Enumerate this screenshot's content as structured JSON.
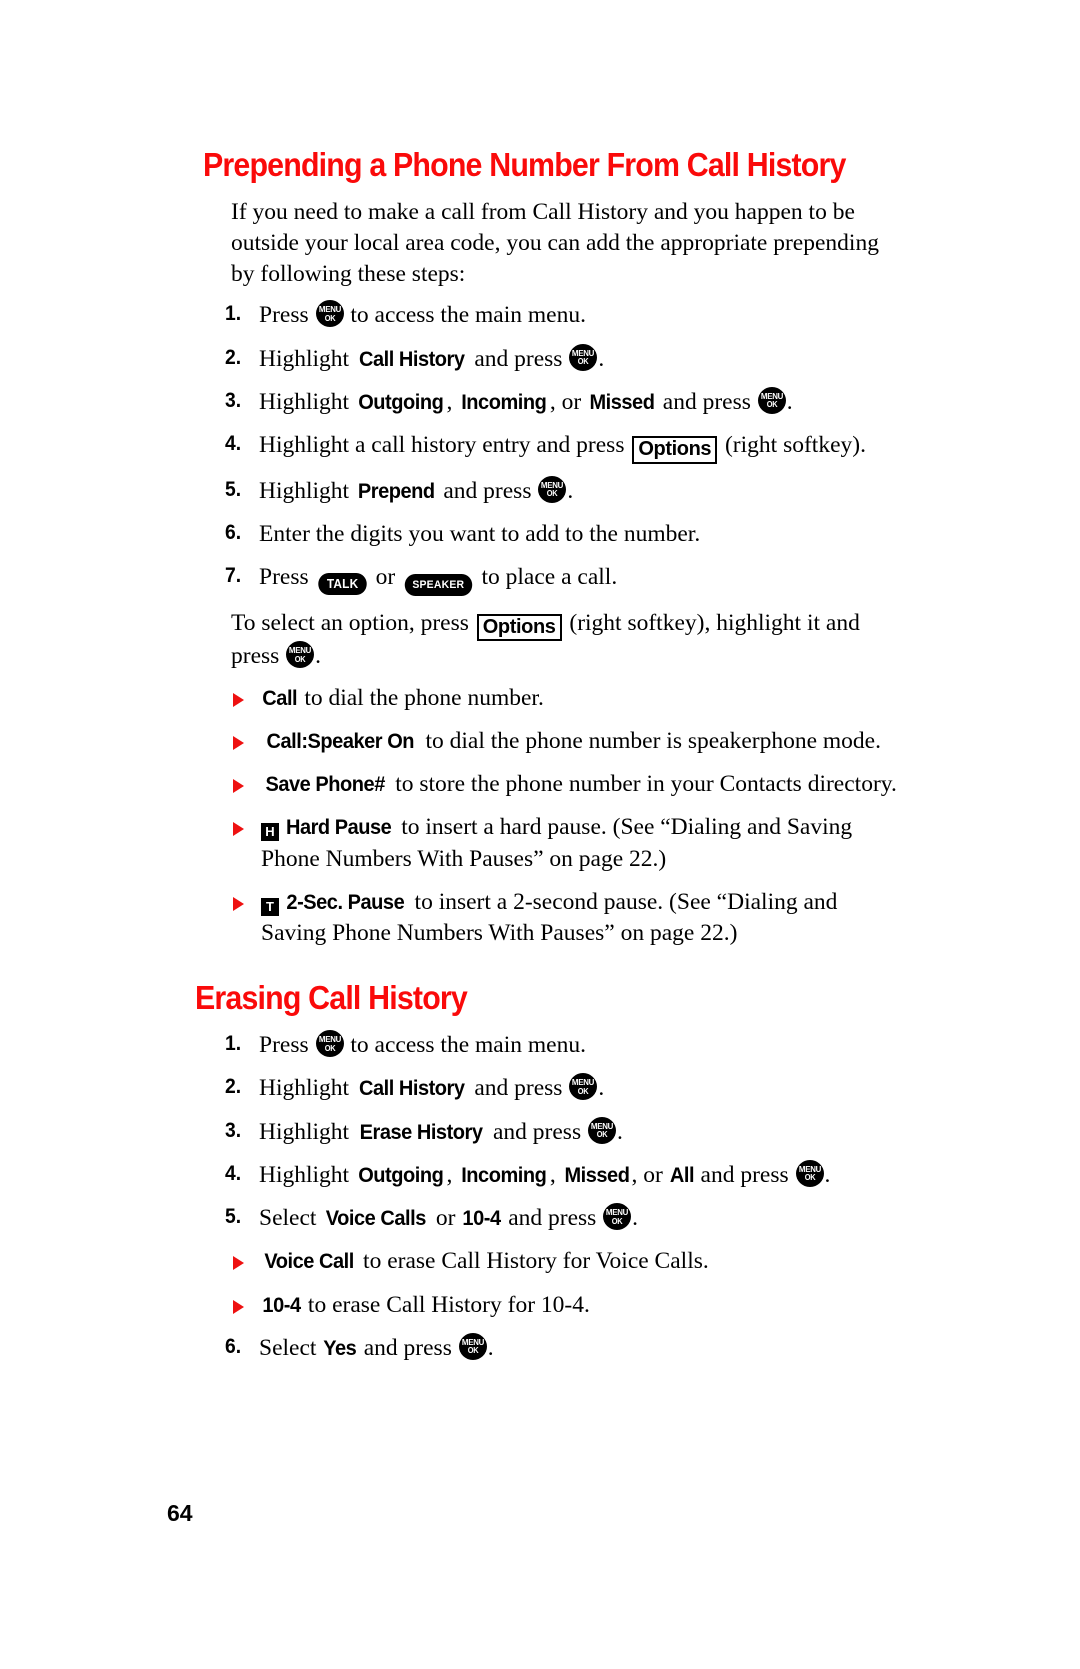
{
  "page": {
    "folio": "64",
    "accent_red": "#fa0a0a",
    "text_black": "#000000",
    "background": "#ffffff"
  },
  "icons": {
    "menu_ok": {
      "line1": "MENU",
      "line2": "OK",
      "name": "menu-ok-key-icon"
    },
    "talk": {
      "label": "TALK",
      "name": "talk-key-icon"
    },
    "speaker": {
      "label": "SPEAKER",
      "name": "speaker-key-icon"
    },
    "options_softkey": {
      "label": "Options",
      "name": "options-softkey-icon"
    },
    "hard_pause": {
      "label": "H",
      "name": "hard-pause-key-icon"
    },
    "two_sec_pause": {
      "label": "T",
      "name": "two-sec-pause-key-icon"
    }
  },
  "sections": [
    {
      "heading": "Prepending a Phone Number From Call History",
      "intro": "If you need to make a call from Call History and you happen to be outside your local area code, you can add the appropriate prepending by following these steps:",
      "steps": [
        {
          "num": "1.",
          "parts": [
            {
              "t": "text",
              "v": "Press "
            },
            {
              "t": "menuok"
            },
            {
              "t": "text",
              "v": " to access the main menu."
            }
          ]
        },
        {
          "num": "2.",
          "parts": [
            {
              "t": "text",
              "v": "Highlight "
            },
            {
              "t": "ui",
              "v": "Call History"
            },
            {
              "t": "text",
              "v": " and press "
            },
            {
              "t": "menuok"
            },
            {
              "t": "text",
              "v": "."
            }
          ]
        },
        {
          "num": "3.",
          "parts": [
            {
              "t": "text",
              "v": "Highlight "
            },
            {
              "t": "ui",
              "v": "Outgoing"
            },
            {
              "t": "text",
              "v": ", "
            },
            {
              "t": "ui",
              "v": "Incoming"
            },
            {
              "t": "text",
              "v": ", or "
            },
            {
              "t": "ui",
              "v": "Missed"
            },
            {
              "t": "text",
              "v": " and press "
            },
            {
              "t": "menuok"
            },
            {
              "t": "text",
              "v": "."
            }
          ]
        },
        {
          "num": "4.",
          "parts": [
            {
              "t": "text",
              "v": "Highlight a call history entry and press "
            },
            {
              "t": "box",
              "v": "Options"
            },
            {
              "t": "text",
              "v": " (right softkey)."
            }
          ]
        },
        {
          "num": "5.",
          "parts": [
            {
              "t": "text",
              "v": "Highlight "
            },
            {
              "t": "ui",
              "v": "Prepend"
            },
            {
              "t": "text",
              "v": " and press "
            },
            {
              "t": "menuok"
            },
            {
              "t": "text",
              "v": "."
            }
          ]
        },
        {
          "num": "6.",
          "parts": [
            {
              "t": "text",
              "v": "Enter the digits you want to add to the number."
            }
          ]
        },
        {
          "num": "7.",
          "parts": [
            {
              "t": "text",
              "v": "Press "
            },
            {
              "t": "pill",
              "v": "TALK"
            },
            {
              "t": "text",
              "v": " or "
            },
            {
              "t": "pillsm",
              "v": "SPEAKER"
            },
            {
              "t": "text",
              "v": " to place a call."
            }
          ]
        }
      ],
      "after_steps_paragraph": [
        {
          "t": "text",
          "v": "To select an option, press "
        },
        {
          "t": "box",
          "v": "Options"
        },
        {
          "t": "text",
          "v": " (right softkey), highlight it and press "
        },
        {
          "t": "menuok"
        },
        {
          "t": "text",
          "v": "."
        }
      ],
      "bullets": [
        {
          "parts": [
            {
              "t": "ui",
              "v": "Call"
            },
            {
              "t": "text",
              "v": " to dial the phone number."
            }
          ]
        },
        {
          "parts": [
            {
              "t": "ui",
              "v": "Call:Speaker On"
            },
            {
              "t": "text",
              "v": " to dial the phone number is speakerphone mode."
            }
          ]
        },
        {
          "parts": [
            {
              "t": "ui",
              "v": "Save Phone#"
            },
            {
              "t": "text",
              "v": " to store the phone number in your Contacts directory."
            }
          ]
        },
        {
          "parts": [
            {
              "t": "sq",
              "v": "H"
            },
            {
              "t": "ui",
              "v": "Hard Pause"
            },
            {
              "t": "text",
              "v": " to insert a hard pause. (See “Dialing and Saving Phone Numbers With Pauses” on page 22.)"
            }
          ]
        },
        {
          "parts": [
            {
              "t": "sq",
              "v": "T"
            },
            {
              "t": "ui",
              "v": "2-Sec. Pause"
            },
            {
              "t": "text",
              "v": " to insert a 2-second pause. (See “Dialing and Saving Phone Numbers With Pauses” on page 22.)"
            }
          ]
        }
      ]
    },
    {
      "heading": "Erasing Call History",
      "intro": "",
      "steps": [
        {
          "num": "1.",
          "parts": [
            {
              "t": "text",
              "v": "Press "
            },
            {
              "t": "menuok"
            },
            {
              "t": "text",
              "v": " to access the main menu."
            }
          ]
        },
        {
          "num": "2.",
          "parts": [
            {
              "t": "text",
              "v": "Highlight "
            },
            {
              "t": "ui",
              "v": "Call History"
            },
            {
              "t": "text",
              "v": " and press "
            },
            {
              "t": "menuok"
            },
            {
              "t": "text",
              "v": "."
            }
          ]
        },
        {
          "num": "3.",
          "parts": [
            {
              "t": "text",
              "v": "Highlight "
            },
            {
              "t": "ui",
              "v": "Erase History"
            },
            {
              "t": "text",
              "v": " and press "
            },
            {
              "t": "menuok"
            },
            {
              "t": "text",
              "v": "."
            }
          ]
        },
        {
          "num": "4.",
          "parts": [
            {
              "t": "text",
              "v": "Highlight "
            },
            {
              "t": "ui",
              "v": "Outgoing"
            },
            {
              "t": "text",
              "v": ", "
            },
            {
              "t": "ui",
              "v": "Incoming"
            },
            {
              "t": "text",
              "v": ", "
            },
            {
              "t": "ui",
              "v": "Missed"
            },
            {
              "t": "text",
              "v": ", or "
            },
            {
              "t": "ui",
              "v": "All"
            },
            {
              "t": "text",
              "v": " and press "
            },
            {
              "t": "menuok"
            },
            {
              "t": "text",
              "v": "."
            }
          ]
        },
        {
          "num": "5.",
          "parts": [
            {
              "t": "text",
              "v": "Select "
            },
            {
              "t": "ui",
              "v": "Voice Calls"
            },
            {
              "t": "text",
              "v": " or "
            },
            {
              "t": "ui",
              "v": "10-4"
            },
            {
              "t": "text",
              "v": " and press "
            },
            {
              "t": "menuok"
            },
            {
              "t": "text",
              "v": "."
            }
          ]
        }
      ],
      "bullets": [
        {
          "parts": [
            {
              "t": "ui",
              "v": "Voice Call"
            },
            {
              "t": "text",
              "v": " to erase Call History for Voice Calls."
            }
          ]
        },
        {
          "parts": [
            {
              "t": "ui",
              "v": "10-4"
            },
            {
              "t": "text",
              "v": " to erase Call History for 10-4."
            }
          ]
        }
      ],
      "final_steps": [
        {
          "num": "6.",
          "parts": [
            {
              "t": "text",
              "v": "Select "
            },
            {
              "t": "ui",
              "v": "Yes"
            },
            {
              "t": "text",
              "v": " and press "
            },
            {
              "t": "menuok"
            },
            {
              "t": "text",
              "v": "."
            }
          ]
        }
      ]
    }
  ]
}
